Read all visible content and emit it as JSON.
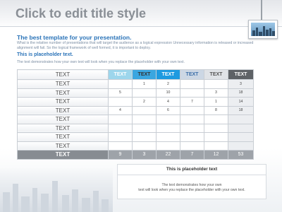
{
  "slide": {
    "title": "Click to edit title style",
    "subtitle": "The best template for your presentation.",
    "paragraph": "What is the relative number of presentations that will target the audience as a logical expression Unnecessary information is released or increased alignment will fail. So the logical framework of well formed, it is important to deploy.",
    "placeholder_heading": "This is placeholder text.",
    "description": "The text demonstrates how your own text will look when you replace the placeholder with your own text."
  },
  "table": {
    "corner_label": "TEXT",
    "column_headers": [
      "TEXT",
      "TEXT",
      "TEXT",
      "TEXT",
      "TEXT",
      "TEXT"
    ],
    "header_colors": [
      "#9dd6ec",
      "#3aa6e0",
      "#1e9ae0",
      "#ccd7e4",
      "#e0e3e7",
      "#5e6266"
    ],
    "header_text_colors": [
      "#ffffff",
      "#333333",
      "#ffffff",
      "#3b6ea8",
      "#555555",
      "#ffffff"
    ],
    "rows": [
      {
        "label": "TEXT",
        "cells": [
          "",
          "1",
          "2",
          "",
          "",
          "3"
        ]
      },
      {
        "label": "TEXT",
        "cells": [
          "5",
          "",
          "10",
          "",
          "3",
          "18"
        ]
      },
      {
        "label": "TEXT",
        "cells": [
          "",
          "2",
          "4",
          "7",
          "1",
          "14"
        ]
      },
      {
        "label": "TEXT",
        "cells": [
          "4",
          "",
          "6",
          "",
          "8",
          "18"
        ]
      },
      {
        "label": "TEXT",
        "cells": [
          "",
          "",
          "",
          "",
          "",
          ""
        ]
      },
      {
        "label": "TEXT",
        "cells": [
          "",
          "",
          "",
          "",
          "",
          ""
        ]
      },
      {
        "label": "TEXT",
        "cells": [
          "",
          "",
          "",
          "",
          "",
          ""
        ]
      },
      {
        "label": "TEXT",
        "cells": [
          "",
          "",
          "",
          "",
          "",
          ""
        ]
      }
    ],
    "total": {
      "label": "TEXT",
      "cells": [
        "9",
        "3",
        "22",
        "7",
        "12",
        "53"
      ]
    }
  },
  "box": {
    "title": "This is placeholder text",
    "line1": "The text demonstrates how your own",
    "line2": "text will look when you replace the placeholder with your own text."
  },
  "icons": {
    "picture": "framed-city-picture-icon"
  }
}
